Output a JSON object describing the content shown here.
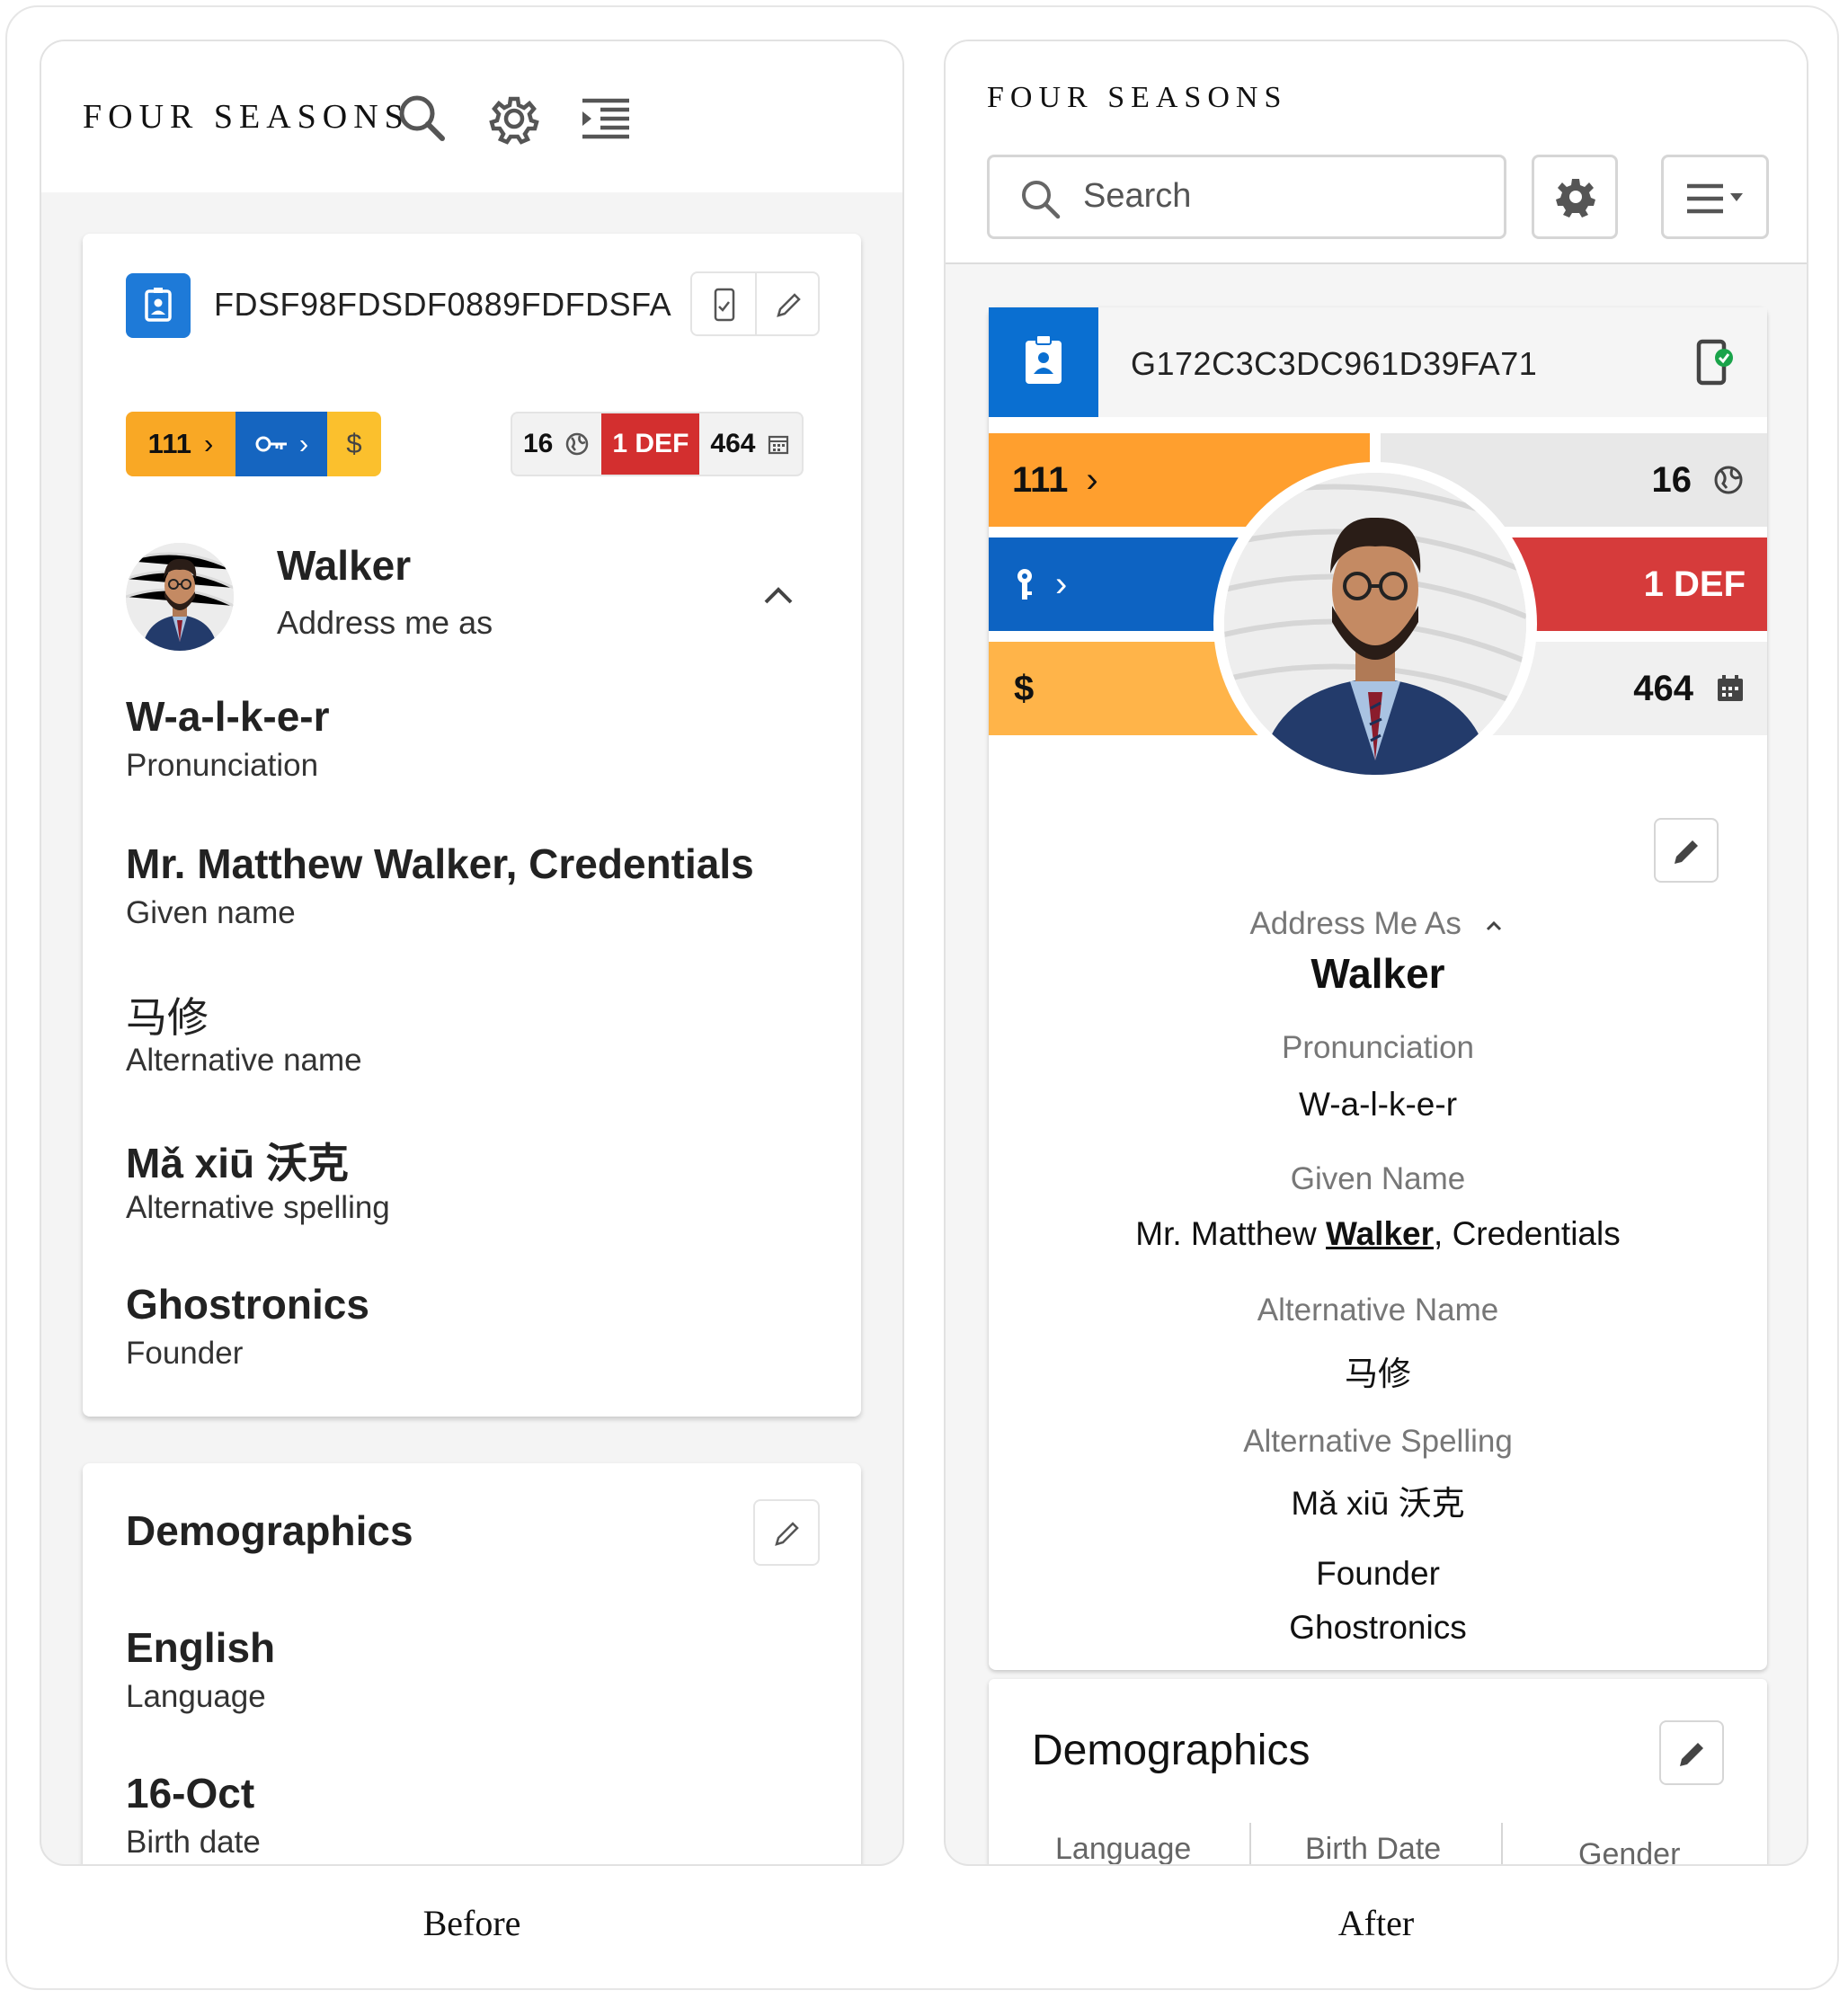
{
  "before": {
    "caption": "Before",
    "brand": "FOUR SEASONS",
    "id": "FDSF98FDSDF0889FDFDSFA",
    "chips": {
      "c1": "111",
      "c3": "$"
    },
    "stats": {
      "count": "16",
      "def": "1 DEF",
      "days": "464"
    },
    "name": "Walker",
    "name_label": "Address me as",
    "fields": [
      {
        "value": "W-a-l-k-e-r",
        "label": "Pronunciation"
      },
      {
        "value": "Mr. Matthew Walker, Credentials",
        "label": "Given name"
      },
      {
        "value": "马修",
        "label": "Alternative name"
      },
      {
        "value": "Mǎ xiū 沃克",
        "label": "Alternative spelling"
      },
      {
        "value": "Ghostronics",
        "label": "Founder"
      }
    ],
    "demographics": {
      "title": "Demographics",
      "fields": [
        {
          "value": "English",
          "label": "Language"
        },
        {
          "value": "16-Oct",
          "label": "Birth date"
        }
      ]
    }
  },
  "after": {
    "caption": "After",
    "brand": "FOUR SEASONS",
    "search_placeholder": "Search",
    "id": "G172C3C3DC961D39FA71",
    "bands": {
      "b1": "111",
      "r1": "16",
      "r2": "1 DEF",
      "l3": "$",
      "r3": "464"
    },
    "address_label": "Address Me As",
    "name": "Walker",
    "fields": [
      {
        "label": "Pronunciation",
        "value": "W-a-l-k-e-r"
      },
      {
        "label": "Given Name",
        "value_pre": "Mr. Matthew ",
        "value_em": "Walker",
        "value_post": ", Credentials"
      },
      {
        "label": "Alternative Name",
        "value": "马修"
      },
      {
        "label": "Alternative Spelling",
        "value": "Mǎ xiū 沃克"
      }
    ],
    "title": "Founder",
    "company": "Ghostronics",
    "demographics": {
      "title": "Demographics",
      "columns": [
        "Language",
        "Birth Date",
        "Gender"
      ]
    }
  },
  "colors": {
    "orange": "#f9a825",
    "blue": "#1565c0",
    "yellow": "#fbc02d",
    "red": "#d32f2f",
    "after_orange": "#ff9f2e",
    "after_blue": "#0d63c2",
    "after_red": "#d63b3b",
    "after_lightorange": "#ffb449"
  }
}
